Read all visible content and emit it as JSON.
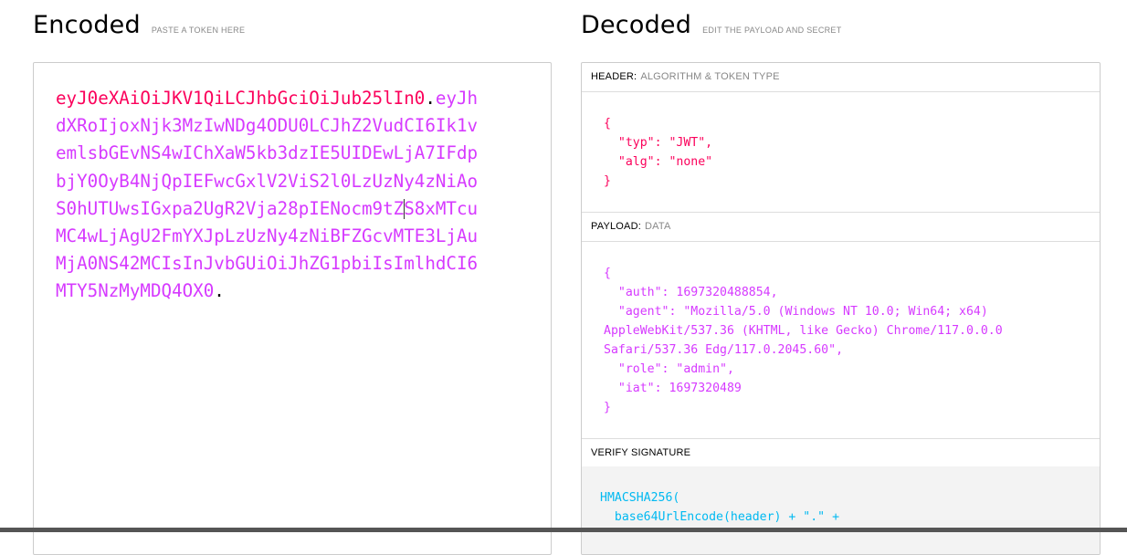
{
  "encoded": {
    "title": "Encoded",
    "subtitle": "PASTE A TOKEN HERE",
    "token_header": "eyJ0eXAiOiJKV1QiLCJhbGciOiJub25lIn0",
    "token_payload_part1": "eyJhdXRoIjoxNjk3MzIwNDg4ODU0LCJhZ2VudCI6Ik1vemlsbGEvNS4wIChXaW5kb3dzIE5UIDEwLjA7IFdpbjY0OyB4NjQpIEFwcGxlV2ViS2l0LzUzNy4zNiAoS0hUTUwsIGxpa2UgR2Vja28pIENocm9tZ",
    "token_payload_part2": "S8xMTcuMC4wLjAgU2FmYXJpLzUzNy4zNiBFZGcvMTE3LjAuMjA0NS42MCIsInJvbGUiOiJhZG1pbiIsImlhdCI6MTY5NzMyMDQ4OX0",
    "dot1": ".",
    "dot2": "."
  },
  "decoded": {
    "title": "Decoded",
    "subtitle": "EDIT THE PAYLOAD AND SECRET",
    "header_section": {
      "label": "HEADER:",
      "sublabel": "ALGORITHM & TOKEN TYPE",
      "json": "{\n  \"typ\": \"JWT\",\n  \"alg\": \"none\"\n}"
    },
    "payload_section": {
      "label": "PAYLOAD:",
      "sublabel": "DATA",
      "json": "{\n  \"auth\": 1697320488854,\n  \"agent\": \"Mozilla/5.0 (Windows NT 10.0; Win64; x64)\nAppleWebKit/537.36 (KHTML, like Gecko) Chrome/117.0.0.0\nSafari/537.36 Edg/117.0.2045.60\",\n  \"role\": \"admin\",\n  \"iat\": 1697320489\n}"
    },
    "verify_section": {
      "label": "VERIFY SIGNATURE",
      "code": "HMACSHA256(\n  base64UrlEncode(header) + \".\" +"
    }
  },
  "colors": {
    "header": "#fb015b",
    "payload": "#d63aff",
    "signature": "#00b9f1"
  }
}
